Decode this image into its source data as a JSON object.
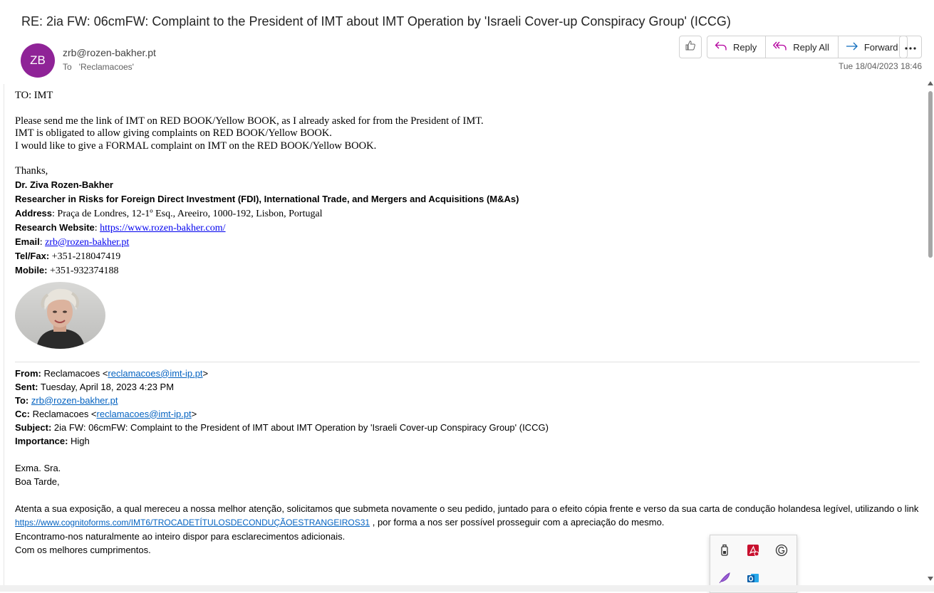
{
  "message": {
    "subject": "RE: 2ia FW: 06cmFW: Complaint to the President of IMT about IMT Operation by 'Israeli Cover-up Conspiracy Group' (ICCG)",
    "avatar_initials": "ZB",
    "avatar_color": "#8f2397",
    "sender": "zrb@rozen-bakher.pt",
    "to_label": "To",
    "to_value": "'Reclamacoes'",
    "date": "Tue 18/04/2023 18:46"
  },
  "actions": {
    "reply": "Reply",
    "reply_all": "Reply All",
    "forward": "Forward"
  },
  "body": {
    "to_line": "TO: IMT",
    "paragraph": [
      "Please send me the link of IMT on RED BOOK/Yellow BOOK, as I already asked for from the President of IMT.",
      "IMT is obligated to allow giving complaints on RED BOOK/Yellow BOOK.",
      "I would like to give a FORMAL complaint on IMT on the RED BOOK/Yellow BOOK."
    ],
    "thanks": "Thanks,"
  },
  "signature": {
    "name": "Dr. Ziva Rozen-Bakher",
    "title": "Researcher in Risks for Foreign Direct Investment (FDI), International Trade, and Mergers and Acquisitions (M&As)",
    "address_label": "Address",
    "address_value": ": Praça de Londres, 12-1º Esq., Areeiro, 1000-192, Lisbon, Portugal",
    "website_label": "Research Website",
    "website_sep": ": ",
    "website_url": "https://www.rozen-bakher.com/",
    "email_label": "Email",
    "email_sep": ": ",
    "email_value": "zrb@rozen-bakher.pt",
    "tel_label": "Tel/Fax:",
    "tel_value": " +351-218047419",
    "mobile_label": "Mobile:",
    "mobile_value": " +351-932374188"
  },
  "quoted": {
    "from_label": "From:",
    "from_name": " Reclamacoes <",
    "from_email": "reclamacoes@imt-ip.pt",
    "from_close": ">",
    "sent_label": "Sent:",
    "sent_value": " Tuesday, April 18, 2023 4:23 PM",
    "to_label": "To:",
    "to_value": "zrb@rozen-bakher.pt",
    "cc_label": "Cc:",
    "cc_name": " Reclamacoes <",
    "cc_email": "reclamacoes@imt-ip.pt",
    "cc_close": ">",
    "subject_label": "Subject:",
    "subject_value": " 2ia FW: 06cmFW: Complaint to the President of IMT about IMT Operation by 'Israeli Cover-up Conspiracy Group' (ICCG)",
    "importance_label": "Importance:",
    "importance_value": " High",
    "greeting1": "Exma. Sra.",
    "greeting2": "Boa Tarde,",
    "para1": "Atenta a sua exposição, a qual mereceu a nossa melhor atenção, solicitamos que submeta novamente o seu pedido, juntado para o efeito cópia frente e verso da sua carta de condução holandesa legível, utilizando o link",
    "link": "https://www.cognitoforms.com/IMT6/TROCADETÍTULOSDECONDUÇÃOESTRANGEIROS31",
    "para2_rest": " , por forma a nos ser possível prosseguir com a apreciação do mesmo.",
    "para3": "Encontramo-nos naturalmente ao inteiro dispor para esclarecimentos adicionais.",
    "para4": "Com os melhores cumprimentos."
  }
}
